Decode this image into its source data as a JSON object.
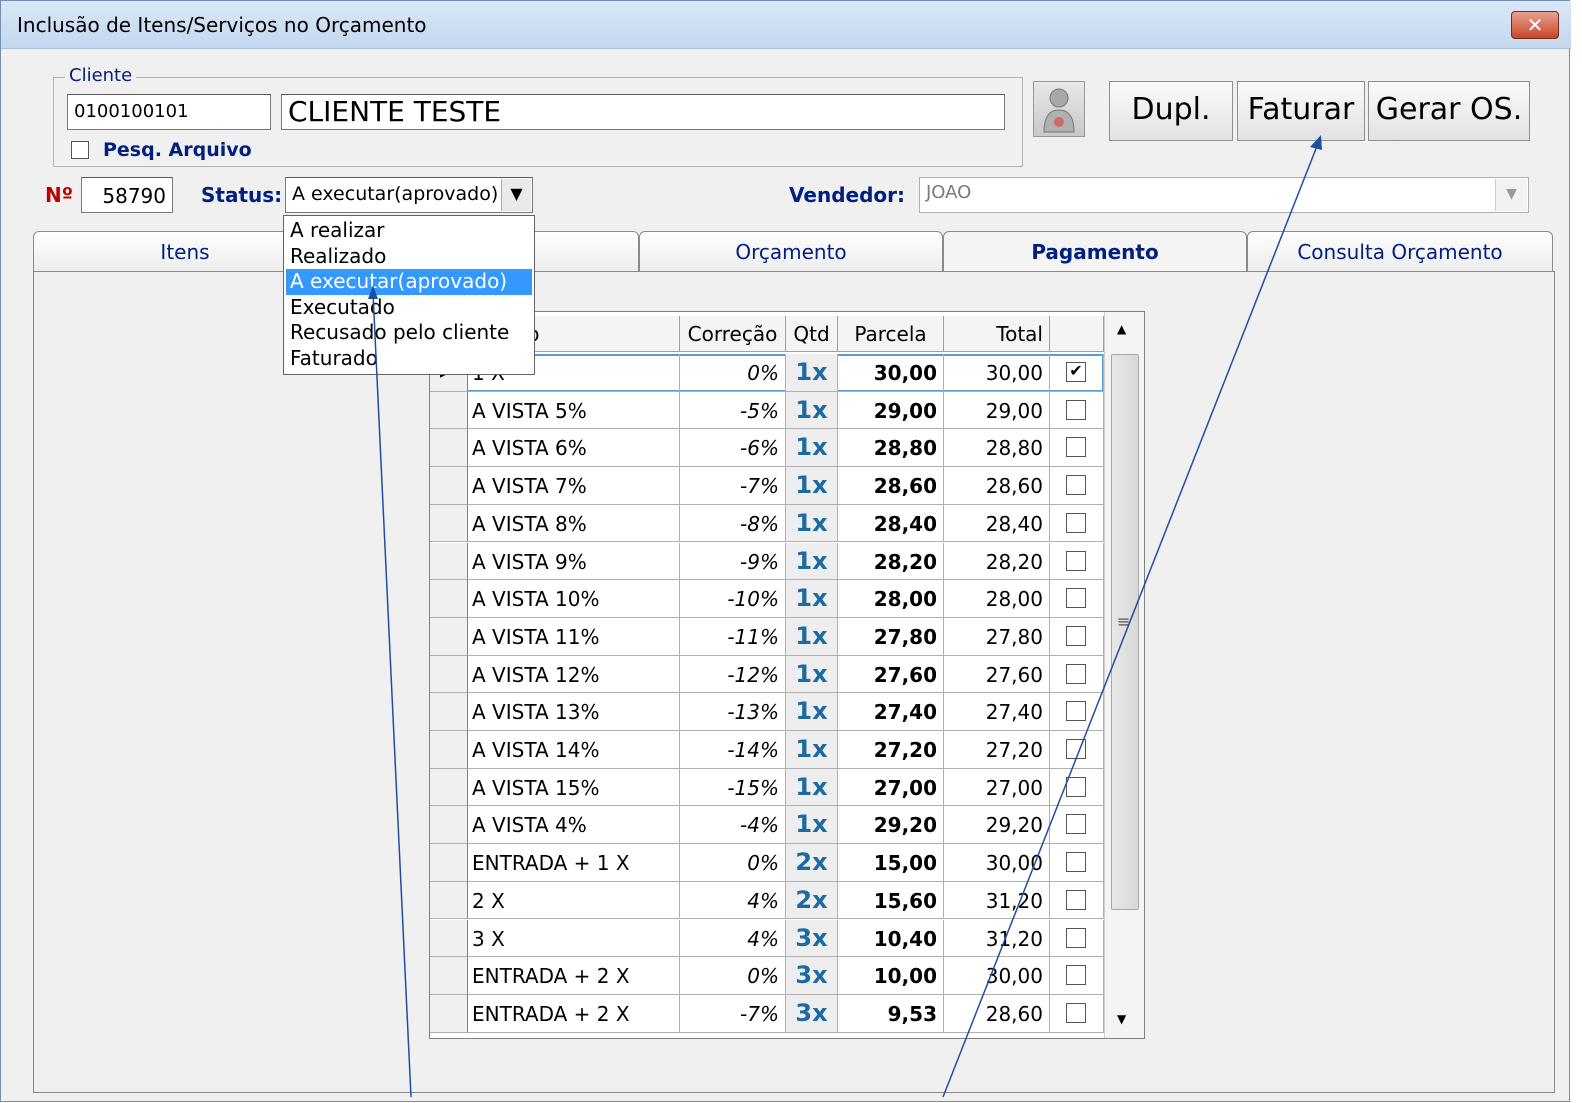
{
  "window": {
    "title": "Inclusão de Itens/Serviços no Orçamento",
    "close_icon": "close-icon"
  },
  "cliente": {
    "legend": "Cliente",
    "code": "0100100101",
    "name": "CLIENTE TESTE",
    "pesq_label": "Pesq. Arquivo",
    "pesq_checked": false,
    "avatar_icon": "person-icon"
  },
  "buttons": {
    "dupl": "Dupl.",
    "faturar": "Faturar",
    "gerar_os": "Gerar OS."
  },
  "order": {
    "numero_label": "Nº",
    "numero": "58790",
    "status_label": "Status:",
    "status_value": "A executar(aprovado)",
    "vendedor_label": "Vendedor:",
    "vendedor_value": "JOAO"
  },
  "status_dropdown": {
    "options": [
      "A realizar",
      "Realizado",
      "A executar(aprovado)",
      "Executado",
      "Recusado pelo cliente",
      "Faturado"
    ],
    "highlighted": "A executar(aprovado)"
  },
  "tabs": [
    {
      "label": "Itens",
      "active": false
    },
    {
      "label": "",
      "active": false
    },
    {
      "label": "Orçamento",
      "active": false
    },
    {
      "label": "Pagamento",
      "active": true
    },
    {
      "label": "Consulta Orçamento",
      "active": false
    }
  ],
  "grid": {
    "headers": {
      "descricao": "ção",
      "correcao": "Correção",
      "qtd": "Qtd",
      "parcela": "Parcela",
      "total": "Total"
    },
    "rows": [
      {
        "descricao": "1 X",
        "correcao": "0%",
        "qtd": "1x",
        "parcela": "30,00",
        "total": "30,00",
        "checked": true,
        "current": true
      },
      {
        "descricao": "A VISTA  5%",
        "correcao": "-5%",
        "qtd": "1x",
        "parcela": "29,00",
        "total": "29,00",
        "checked": false
      },
      {
        "descricao": "A VISTA  6%",
        "correcao": "-6%",
        "qtd": "1x",
        "parcela": "28,80",
        "total": "28,80",
        "checked": false
      },
      {
        "descricao": "A VISTA  7%",
        "correcao": "-7%",
        "qtd": "1x",
        "parcela": "28,60",
        "total": "28,60",
        "checked": false
      },
      {
        "descricao": "A VISTA  8%",
        "correcao": "-8%",
        "qtd": "1x",
        "parcela": "28,40",
        "total": "28,40",
        "checked": false
      },
      {
        "descricao": "A VISTA  9%",
        "correcao": "-9%",
        "qtd": "1x",
        "parcela": "28,20",
        "total": "28,20",
        "checked": false
      },
      {
        "descricao": "A VISTA 10%",
        "correcao": "-10%",
        "qtd": "1x",
        "parcela": "28,00",
        "total": "28,00",
        "checked": false
      },
      {
        "descricao": "A VISTA 11%",
        "correcao": "-11%",
        "qtd": "1x",
        "parcela": "27,80",
        "total": "27,80",
        "checked": false
      },
      {
        "descricao": "A VISTA 12%",
        "correcao": "-12%",
        "qtd": "1x",
        "parcela": "27,60",
        "total": "27,60",
        "checked": false
      },
      {
        "descricao": "A VISTA 13%",
        "correcao": "-13%",
        "qtd": "1x",
        "parcela": "27,40",
        "total": "27,40",
        "checked": false
      },
      {
        "descricao": "A VISTA 14%",
        "correcao": "-14%",
        "qtd": "1x",
        "parcela": "27,20",
        "total": "27,20",
        "checked": false
      },
      {
        "descricao": "A VISTA 15%",
        "correcao": "-15%",
        "qtd": "1x",
        "parcela": "27,00",
        "total": "27,00",
        "checked": false
      },
      {
        "descricao": "A VISTA 4%",
        "correcao": "-4%",
        "qtd": "1x",
        "parcela": "29,20",
        "total": "29,20",
        "checked": false
      },
      {
        "descricao": "ENTRADA + 1 X",
        "correcao": "0%",
        "qtd": "2x",
        "parcela": "15,00",
        "total": "30,00",
        "checked": false
      },
      {
        "descricao": "2 X",
        "correcao": "4%",
        "qtd": "2x",
        "parcela": "15,60",
        "total": "31,20",
        "checked": false
      },
      {
        "descricao": "3 X",
        "correcao": "4%",
        "qtd": "3x",
        "parcela": "10,40",
        "total": "31,20",
        "checked": false
      },
      {
        "descricao": "ENTRADA + 2 X",
        "correcao": "0%",
        "qtd": "3x",
        "parcela": "10,00",
        "total": "30,00",
        "checked": false
      },
      {
        "descricao": "ENTRADA + 2 X",
        "correcao": "-7%",
        "qtd": "3x",
        "parcela": "9,53",
        "total": "28,60",
        "checked": false
      }
    ]
  },
  "colors": {
    "accent_blue": "#002080",
    "qtd_blue": "#1b6aa0",
    "highlight": "#3399ff",
    "annotation_line": "#1f4fa0"
  }
}
